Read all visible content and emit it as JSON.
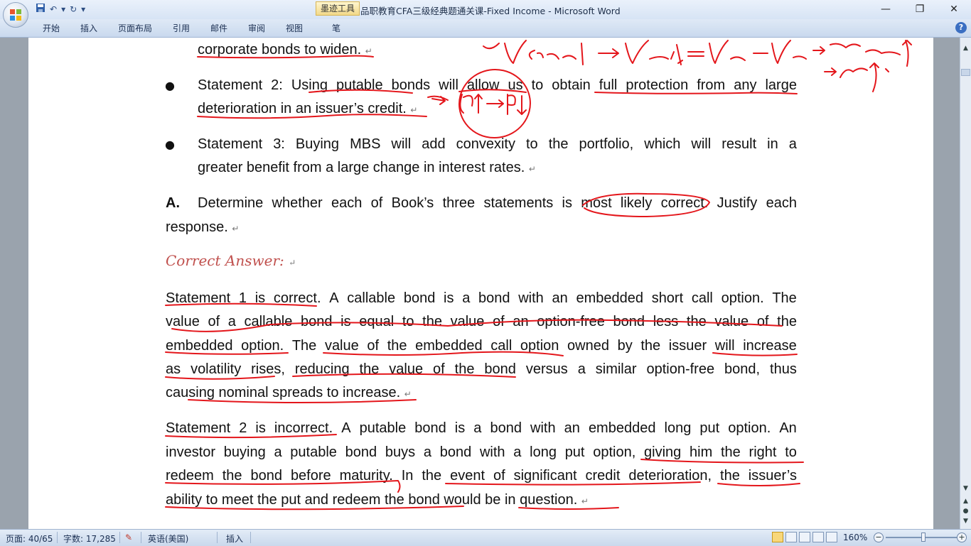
{
  "window": {
    "title": "品职教育CFA三级经典题通关课-Fixed Income - Microsoft Word",
    "contextual_tab": "墨迹工具",
    "controls": {
      "minimize": "—",
      "restore": "❐",
      "close": "✕"
    }
  },
  "qat": {
    "save_icon": "save-icon",
    "undo": "↶",
    "undo_arrow": "▾",
    "redo": "↻",
    "customize": "▾"
  },
  "ribbon": {
    "tabs": [
      "开始",
      "插入",
      "页面布局",
      "引用",
      "邮件",
      "审阅",
      "视图",
      "笔"
    ],
    "help": "?"
  },
  "document": {
    "top_line": "corporate bonds to widen.",
    "statement2": {
      "line1": [
        "Statement",
        "2:",
        "Using",
        "putable",
        "bonds",
        "will",
        "allow",
        "us",
        "to",
        "obtain",
        "full",
        "protection",
        "from",
        "any",
        "large"
      ],
      "line2": "deterioration in an issuer’s credit."
    },
    "statement3": {
      "line1": [
        "Statement",
        "3:",
        "Buying",
        "MBS",
        "will",
        "add",
        "convexity",
        "to",
        "the",
        "portfolio,",
        "which",
        "will",
        "result",
        "in",
        "a"
      ],
      "line2": "greater benefit from a large change in interest rates."
    },
    "question": {
      "label": "A.",
      "line1": [
        "Determine",
        "whether",
        "each",
        "of",
        "Book’s",
        "three",
        "statements",
        "is",
        "most",
        "likely",
        "correct.",
        "Justify",
        "each"
      ],
      "line2": "response."
    },
    "correct_answer_label": "Correct Answer:",
    "para1": {
      "line1": [
        "Statement",
        "1",
        "is",
        "correct.",
        "A",
        "callable",
        "bond",
        "is",
        "a",
        "bond",
        "with",
        "an",
        "embedded",
        "short",
        "call",
        "option.",
        "The"
      ],
      "line2": [
        "value",
        "of",
        "a",
        "callable",
        "bond",
        "is",
        "equal",
        "to",
        "the",
        "value",
        "of",
        "an",
        "option-free",
        "bond",
        "less",
        "the",
        "value",
        "of",
        "the"
      ],
      "line3": [
        "embedded",
        "option.",
        "The",
        "value",
        "of",
        "the",
        "embedded",
        "call",
        "option",
        "owned",
        "by",
        "the",
        "issuer",
        "will",
        "increase"
      ],
      "line4": [
        "as",
        "volatility",
        "rises,",
        "reducing",
        "the",
        "value",
        "of",
        "the",
        "bond",
        "versus",
        "a",
        "similar",
        "option-free",
        "bond,",
        "thus"
      ],
      "line5": "causing nominal spreads to increase."
    },
    "para2": {
      "line1": [
        "Statement",
        "2",
        "is",
        "incorrect.",
        "A",
        "putable",
        "bond",
        "is",
        "a",
        "bond",
        "with",
        "an",
        "embedded",
        "long",
        "put",
        "option.",
        "An"
      ],
      "line2": [
        "investor",
        "buying",
        "a",
        "putable",
        "bond",
        "buys",
        "a",
        "bond",
        "with",
        "a",
        "long",
        "put",
        "option,",
        "giving",
        "him",
        "the",
        "right",
        "to"
      ],
      "line3": [
        "redeem",
        "the",
        "bond",
        "before",
        "maturity.",
        "In",
        "the",
        "event",
        "of",
        "significant",
        "credit",
        "deterioration,",
        "the",
        "issuer’s"
      ],
      "line4": "ability to meet the put and redeem the bond would be in question."
    },
    "paragraph_mark": "↵",
    "bullet": "●"
  },
  "ink_colors": {
    "pen": "#e4161b"
  },
  "statusbar": {
    "page": "页面: 40/65",
    "words": "字数: 17,285",
    "language": "英语(美国)",
    "insert_mode": "插入",
    "zoom": "160%",
    "zoom_minus": "−",
    "zoom_plus": "+"
  },
  "scrollbar": {
    "up": "▲",
    "down": "▼",
    "prev": "▲",
    "select": "●",
    "next": "▼"
  }
}
